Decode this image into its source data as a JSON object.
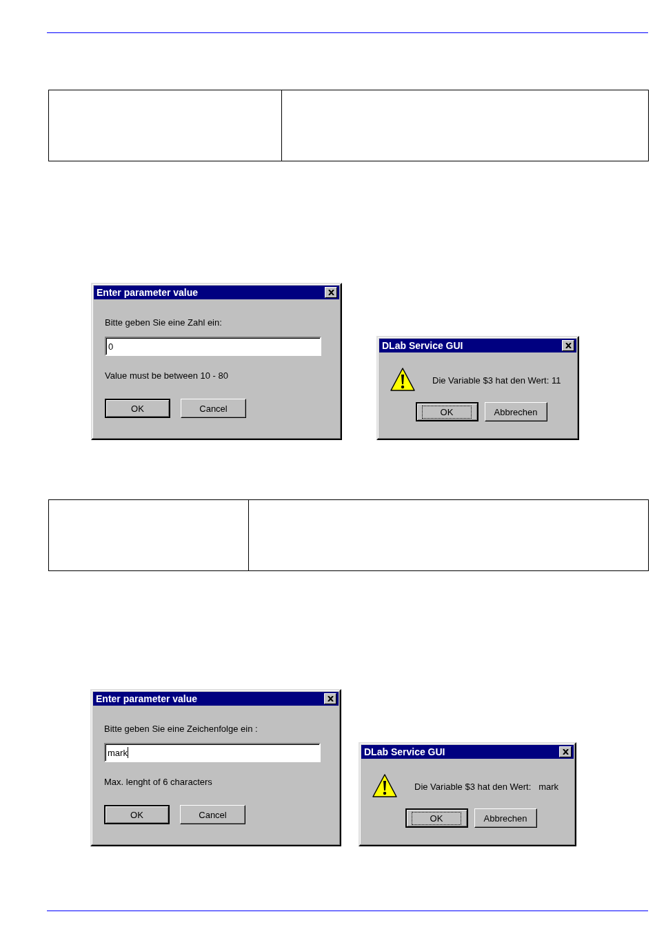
{
  "sections": [
    {
      "dialogs": [
        {
          "kind": "input",
          "title": "Enter parameter value",
          "prompt": "Bitte geben Sie eine Zahl ein:",
          "value": "0",
          "focused": false,
          "hint": "Value must be between 10 - 80",
          "buttons": [
            {
              "label": "OK",
              "default": true,
              "focused": false
            },
            {
              "label": "Cancel",
              "default": false,
              "focused": false
            }
          ]
        },
        {
          "kind": "message",
          "title": "DLab Service GUI",
          "message": "Die Variable $3 hat den Wert: 11",
          "buttons": [
            {
              "label": "OK",
              "default": true,
              "focused": true
            },
            {
              "label": "Abbrechen",
              "default": false,
              "focused": false
            }
          ]
        }
      ]
    },
    {
      "dialogs": [
        {
          "kind": "input",
          "title": "Enter parameter value",
          "prompt": "Bitte geben Sie eine Zeichenfolge ein :",
          "value": "mark",
          "focused": true,
          "hint": "Max. lenght of 6 characters",
          "buttons": [
            {
              "label": "OK",
              "default": true,
              "focused": false
            },
            {
              "label": "Cancel",
              "default": false,
              "focused": false
            }
          ]
        },
        {
          "kind": "message",
          "title": "DLab Service GUI",
          "message": "Die Variable $3 hat den Wert:   mark",
          "buttons": [
            {
              "label": "OK",
              "default": true,
              "focused": true
            },
            {
              "label": "Abbrechen",
              "default": false,
              "focused": false
            }
          ]
        }
      ]
    }
  ]
}
